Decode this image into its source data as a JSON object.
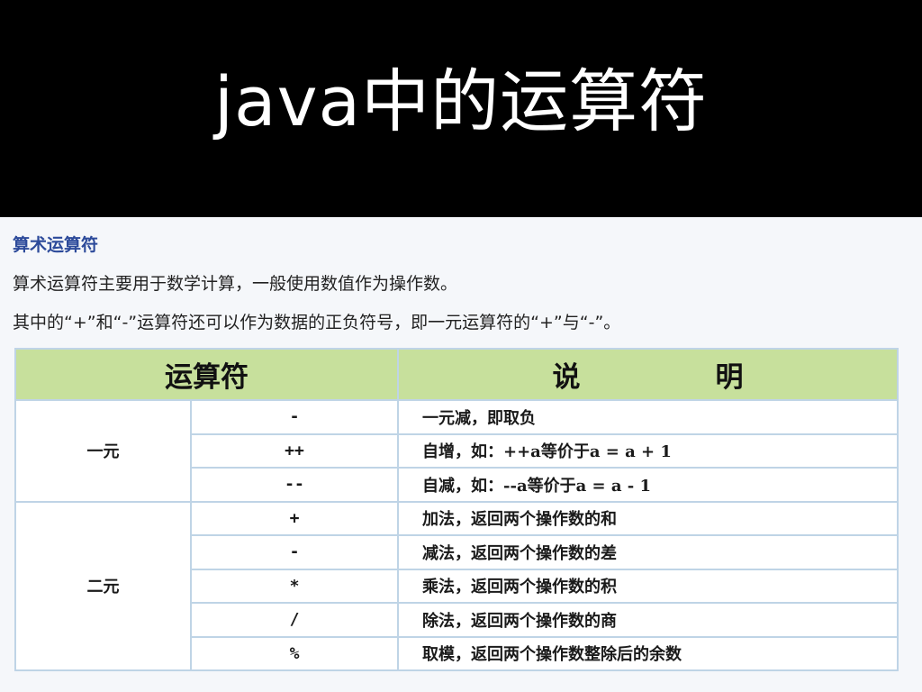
{
  "slide_title": "java中的运算符",
  "section": {
    "heading": "算术运算符",
    "paragraphs": [
      "算术运算符主要用于数学计算，一般使用数值作为操作数。",
      "其中的“+”和“-”运算符还可以作为数据的正负符号，即一元运算符的“+”与“-”。"
    ]
  },
  "table": {
    "headers": {
      "operator": "运算符",
      "desc_part1": "说",
      "desc_part2": "明"
    },
    "groups": [
      {
        "type": "一元",
        "rows": [
          {
            "op": "-",
            "desc": "一元减，即取负"
          },
          {
            "op": "++",
            "desc": "自增，如：++a等价于a = a + 1"
          },
          {
            "op": "--",
            "desc": "自减，如：--a等价于a = a - 1"
          }
        ]
      },
      {
        "type": "二元",
        "rows": [
          {
            "op": "+",
            "desc": "加法，返回两个操作数的和"
          },
          {
            "op": "-",
            "desc": "减法，返回两个操作数的差"
          },
          {
            "op": "*",
            "desc": "乘法，返回两个操作数的积"
          },
          {
            "op": "/",
            "desc": "除法，返回两个操作数的商"
          },
          {
            "op": "%",
            "desc": "取模，返回两个操作数整除后的余数"
          }
        ]
      }
    ]
  }
}
